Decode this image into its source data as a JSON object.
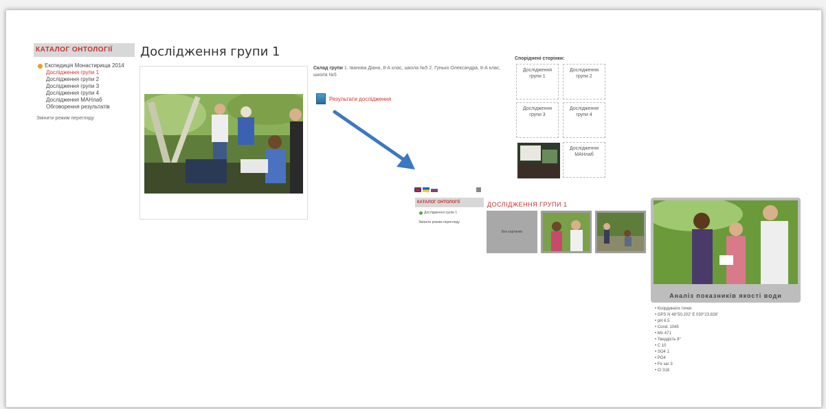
{
  "left_menu": {
    "catalog_title": "КАТАЛОГ ОНТОЛОГІЇ",
    "root_item": "Експедиція Монастирища 2014",
    "items": [
      "Дослідження групи 1",
      "Дослідження групи 2",
      "Дослідження групи 3",
      "Дослідження групи 4",
      "Дослідження МАНлаб",
      "Обговорення результатів"
    ],
    "switch_view": "Змінити режим перегляду"
  },
  "main": {
    "title": "Дослідження групи 1",
    "composition_label": "Склад групи",
    "composition_text": "1. Іванова Діана, 8-А клас, школа №5 2. Гунько Олександра, 8-А клас, школа №5",
    "results_link": "Результати дослідження"
  },
  "related": {
    "title": "Споріднені сторінки:",
    "items": [
      "Дослідження групи 1",
      "Дослідження групи 2",
      "Дослідження групи 3",
      "Дослідження групи 4",
      "Дослідження МАНлаб"
    ]
  },
  "mini_page": {
    "catalog_title": "КАТАЛОГ ОНТОЛОГІЇ",
    "item": "Дослідження групи 1",
    "switch_view": "Змінити режим перегляду",
    "heading": "ДОСЛІДЖЕННЯ ГРУПИ 1",
    "placeholder": "Без картинки",
    "big_caption": "Аналіз показників якості води",
    "params": [
      "• Координати точки",
      "• GPS N 48°50.202' E 030°23.828'",
      "• pH 6.5",
      "• Cond. 1045",
      "• Mn 471",
      "• Твердість 8°",
      "• C 10",
      "• SO4 1",
      "• PO4",
      "• Fe заг 3",
      "• Cl 318"
    ]
  },
  "colors": {
    "accent_red": "#c8302a",
    "arrow_blue": "#3a78c2"
  }
}
